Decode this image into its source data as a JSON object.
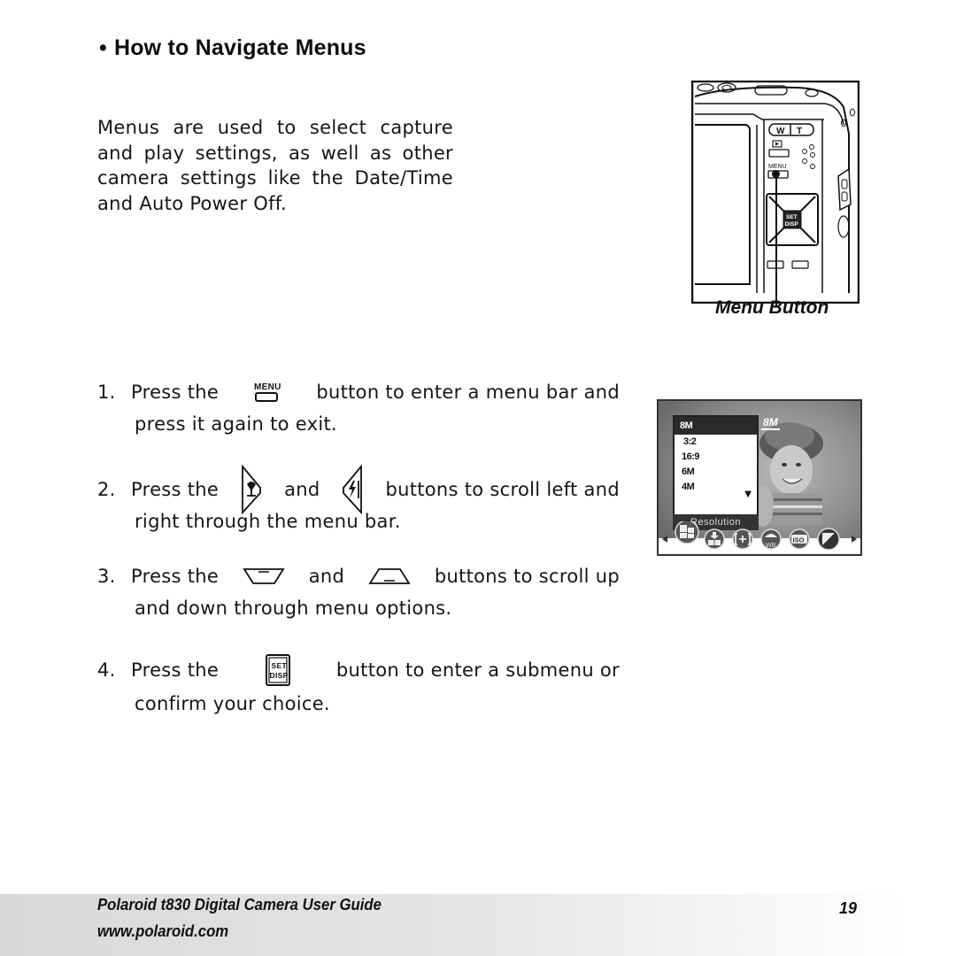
{
  "section": {
    "bullet": "•",
    "title": "How to Navigate Menus",
    "intro_lines": [
      "Menus are used to select capture",
      "and play settings, as well as other",
      "camera settings like the Date/Time",
      "and Auto Power Off."
    ]
  },
  "figure_camera": {
    "callout_label": "Menu Button",
    "button_labels": {
      "zoom_wide": "W",
      "zoom_tele": "T",
      "menu": "MENU",
      "set": "SET",
      "disp": "DISP"
    }
  },
  "steps": [
    {
      "number": "1.",
      "line1_before": "Press the",
      "icon1": "menu-button-icon",
      "icon1_label": "MENU",
      "line1_after": "button to enter a menu bar and",
      "line2": "press it again to exit."
    },
    {
      "number": "2.",
      "line1_before": "Press the",
      "icon1": "left-macro-button-icon",
      "connector": "and",
      "icon2": "right-flash-button-icon",
      "line1_after": "buttons to scroll left and",
      "line2": "right through the menu bar."
    },
    {
      "number": "3.",
      "line1_before": "Press the",
      "icon1": "down-button-icon",
      "connector": "and",
      "icon2": "up-button-icon",
      "line1_after": "buttons to scroll up",
      "line2": "and down through menu options."
    },
    {
      "number": "4.",
      "line1_before": "Press the",
      "icon1": "set-disp-button-icon",
      "icon1_label_top": "SET",
      "icon1_label_bottom": "DISP",
      "line1_after": "button to enter a submenu or",
      "line2": "confirm your choice."
    }
  ],
  "figure_lcd": {
    "menu_options": [
      "8M",
      "3:2",
      "16:9",
      "6M",
      "4M"
    ],
    "selected_option": "8M",
    "more_indicator": "▼",
    "menu_title": "Resolution",
    "resolution_badge": "8M",
    "menu_bar_icons": [
      "resolution-icon",
      "quality-icon",
      "metering-icon",
      "white-balance-icon",
      "iso-icon",
      "exposure-icon"
    ],
    "wb_label": "WB",
    "iso_label": "ISO",
    "nav_left": "◀",
    "nav_right": "▶"
  },
  "footer": {
    "title": "Polaroid t830 Digital Camera User Guide",
    "url": "www.polaroid.com",
    "page_number": "19"
  }
}
